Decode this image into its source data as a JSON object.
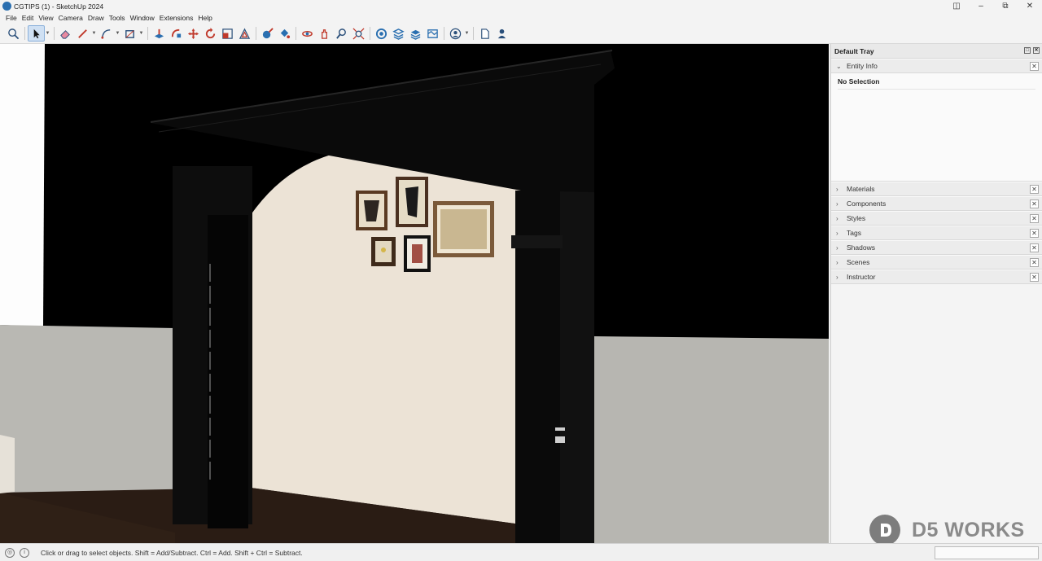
{
  "window": {
    "title": "CGTIPS (1) - SketchUp 2024",
    "app_icon": "sketchup-logo-icon",
    "controls": [
      "layout-icon",
      "minimize-icon",
      "restore-icon",
      "close-icon"
    ]
  },
  "menu": [
    "File",
    "Edit",
    "View",
    "Camera",
    "Draw",
    "Tools",
    "Window",
    "Extensions",
    "Help"
  ],
  "toolbar": {
    "tools": [
      "search-icon",
      "select-icon",
      "eraser-icon",
      "pencil-line-icon",
      "arc-icon",
      "rectangle-icon",
      "push-pull-icon",
      "follow-me-icon",
      "move-icon",
      "rotate-icon",
      "scale-icon",
      "offset-icon",
      "tape-measure-icon",
      "paint-bucket-icon",
      "orbit-icon",
      "pan-icon",
      "zoom-icon",
      "zoom-extents-icon",
      "warehouse-icon",
      "extension-warehouse-icon",
      "layers-icon",
      "sandbox-icon",
      "account-icon",
      "new-file-icon",
      "profile-icon"
    ],
    "active_tool": "select-icon"
  },
  "tray": {
    "title": "Default Tray",
    "entity_info": {
      "label": "Entity Info",
      "selection": "No Selection"
    },
    "panels": [
      "Materials",
      "Components",
      "Styles",
      "Tags",
      "Shadows",
      "Scenes",
      "Instructor"
    ]
  },
  "status": {
    "message": "Click or drag to select objects. Shift = Add/Subtract. Ctrl = Add. Shift + Ctrl = Subtract.",
    "icons": [
      "geo-location-icon",
      "info-icon"
    ]
  },
  "watermark": {
    "text": "D5 WORKS",
    "logo": "d5-logo-icon"
  },
  "colors": {
    "accent": "#2a6fb0",
    "wall": "#ece3d6",
    "floor": "#2a1c14",
    "side_wall": "#b9b8b3",
    "arch": "#0a0a0a"
  }
}
